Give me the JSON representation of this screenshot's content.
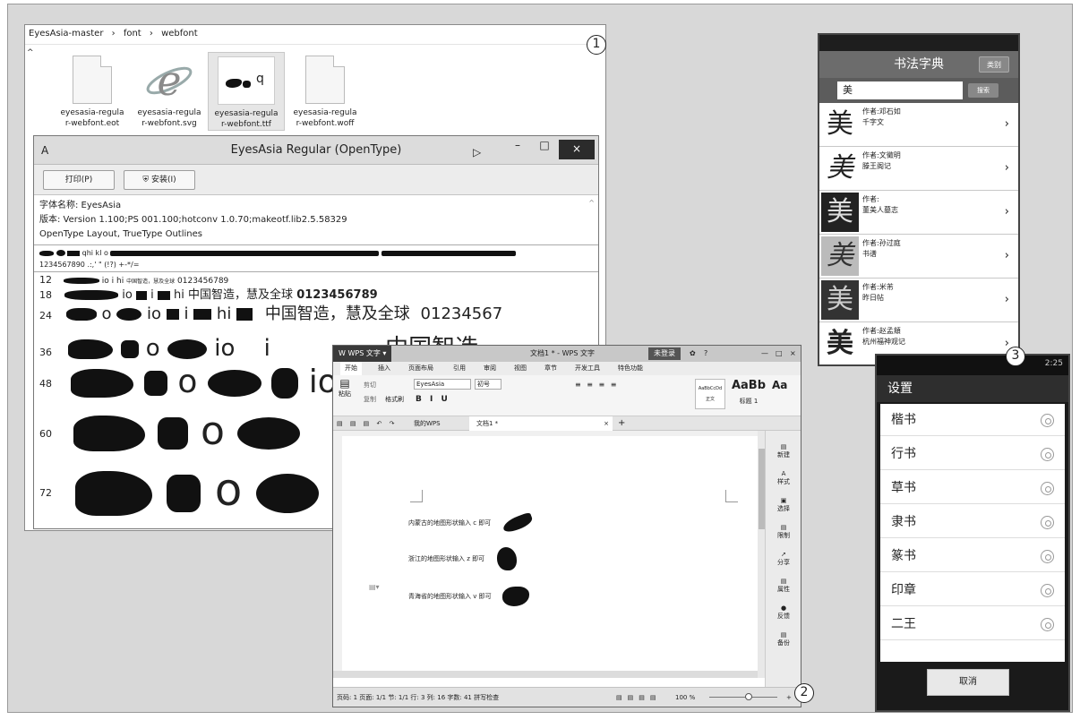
{
  "badges": [
    "1",
    "2",
    "3"
  ],
  "explorer": {
    "breadcrumb": [
      "EyesAsia-master",
      "font",
      "webfont"
    ],
    "breadcrumb_sep": "›",
    "files": [
      {
        "name": "eyesasia-regular-webfont.eot",
        "l1": "eyesasia-regula",
        "l2": "r-webfont.eot",
        "icon": "document-icon"
      },
      {
        "name": "eyesasia-regular-webfont.svg",
        "l1": "eyesasia-regula",
        "l2": "r-webfont.svg",
        "icon": "internet-explorer-icon"
      },
      {
        "name": "eyesasia-regular-webfont.ttf",
        "l1": "eyesasia-regula",
        "l2": "r-webfont.ttf",
        "icon": "font-preview-icon",
        "preview": "q"
      },
      {
        "name": "eyesasia-regular-webfont.woff",
        "l1": "eyesasia-regula",
        "l2": "r-webfont.woff",
        "icon": "document-icon"
      }
    ]
  },
  "font_viewer": {
    "title": "EyesAsia Regular (OpenType)",
    "print_button": "打印(P)",
    "install_button": "安装(I)",
    "info": {
      "font_name": "字体名称: EyesAsia",
      "version": "版本: Version 1.100;PS 001.100;hotconv 1.0.70;makeotf.lib2.5.58329",
      "type": "OpenType Layout, TrueType Outlines"
    },
    "charset_line1": "qhi kl o",
    "charset_line2": "1234567890 .:,' \" (!?) +-*/=",
    "sample_sizes": [
      "12",
      "18",
      "24",
      "36",
      "48",
      "60",
      "72"
    ],
    "sample_fragments": {
      "io": "io",
      "i": "i",
      "hi": "hi",
      "o": "o"
    },
    "sample_cjk": "中国智造，慧及全球",
    "sample_cjk_36": "中国智造",
    "sample_digits": "0123456789",
    "sample_digits_24": "01234567"
  },
  "wps": {
    "app_label": "WPS 文字",
    "doc_title": "文档1 * - WPS 文字",
    "login": "未登录",
    "menu": [
      "开始",
      "插入",
      "页面布局",
      "引用",
      "审阅",
      "视图",
      "章节",
      "开发工具",
      "特色功能"
    ],
    "ribbon": {
      "paste": "粘贴",
      "cut": "剪切",
      "copy": "复制",
      "format_painter": "格式刷",
      "font": "EyesAsia",
      "size": "初号",
      "style_normal": "正文",
      "style_h1": "标题 1",
      "style_preview_1": "AaBbCcDd",
      "style_preview_2": "AaBb",
      "style_preview_3": "Aa"
    },
    "tabs": [
      "我的WPS",
      "文档1 *"
    ],
    "lines": [
      {
        "text": "内蒙古的地图形状输入 c 即可",
        "shape": "inner-mongolia-shape"
      },
      {
        "text": "浙江的地图形状输入 z 即可",
        "shape": "zhejiang-shape"
      },
      {
        "text": "青海省的地图形状输入 v 即可",
        "shape": "qinghai-shape"
      }
    ],
    "side": [
      "新建",
      "样式",
      "选择",
      "限制",
      "分享",
      "属性",
      "反馈",
      "备份"
    ],
    "status": "页码: 1  页面: 1/1  节: 1/1  行: 3  列: 16  字数: 41  拼写检查",
    "zoom": "100 %"
  },
  "phone1": {
    "title": "书法字典",
    "category_button": "类别",
    "search_value": "美",
    "search_button": "搜索",
    "glyph": "美",
    "entries": [
      {
        "author": "作者:邓石如",
        "work": "千字文"
      },
      {
        "author": "作者:文徵明",
        "work": "滕王阁记"
      },
      {
        "author": "作者:",
        "work": "董美人墓志"
      },
      {
        "author": "作者:孙过庭",
        "work": "书谱"
      },
      {
        "author": "作者:米芾",
        "work": "昨日帖"
      },
      {
        "author": "作者:赵孟頫",
        "work": "杭州福神观记"
      }
    ]
  },
  "phone2": {
    "title": "设置",
    "options": [
      "楷书",
      "行书",
      "草书",
      "隶书",
      "篆书",
      "印章",
      "二王"
    ],
    "cancel": "取消",
    "time": "2:25"
  }
}
